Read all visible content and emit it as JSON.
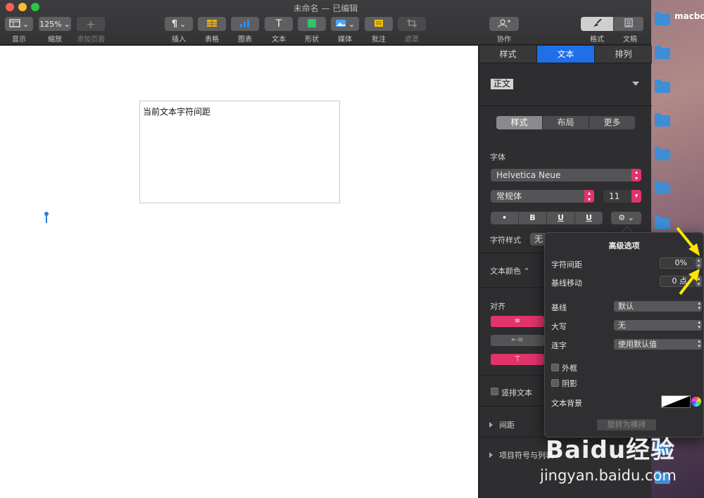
{
  "window": {
    "title": "未命名 — 已编辑"
  },
  "desktop": {
    "item_label": "macboo"
  },
  "toolbar": {
    "view_label": "显示",
    "zoom_value": "125%",
    "zoom_label": "缩放",
    "add_page_label": "添加页面",
    "insert_label": "插入",
    "table_label": "表格",
    "chart_label": "图表",
    "text_label": "文本",
    "shape_label": "形状",
    "media_label": "媒体",
    "comment_label": "批注",
    "mask_label": "遮罩",
    "collaborate_label": "协作",
    "format_label": "格式",
    "document_label": "文稿"
  },
  "document": {
    "text_box_content": "当前文本字符间距"
  },
  "inspector": {
    "tabs": [
      "样式",
      "文本",
      "排列"
    ],
    "active_tab": "文本",
    "paragraph_style": "正文",
    "segments": [
      "样式",
      "布局",
      "更多"
    ],
    "active_segment": "样式",
    "font_section_label": "字体",
    "font_family": "Helvetica Neue",
    "font_style": "常规体",
    "font_size": "11",
    "format_buttons": [
      "•",
      "B",
      "U",
      "U"
    ],
    "char_style_label": "字符样式",
    "char_style_value": "无",
    "text_color_label": "文本颜色",
    "align_label": "对齐",
    "vertical_text_label": "竖排文本",
    "spacing_label": "间距",
    "bullets_label": "项目符号与列表"
  },
  "advanced": {
    "title": "高级选项",
    "char_spacing_label": "字符间距",
    "char_spacing_value": "0%",
    "baseline_shift_label": "基线移动",
    "baseline_shift_value": "0 点",
    "baseline_label": "基线",
    "baseline_value": "默认",
    "caps_label": "大写",
    "caps_value": "无",
    "ligature_label": "连字",
    "ligature_value": "使用默认值",
    "outline_label": "外框",
    "shadow_label": "阴影",
    "text_bg_label": "文本背景",
    "convert_button": "旋转为横排"
  },
  "watermark": {
    "line1": "Baidu经验",
    "line2": "jingyan.baidu.com"
  },
  "colors": {
    "accent_pink": "#e2336b",
    "tab_blue": "#1f6fe6",
    "highlight_arrow": "#ffe600"
  }
}
